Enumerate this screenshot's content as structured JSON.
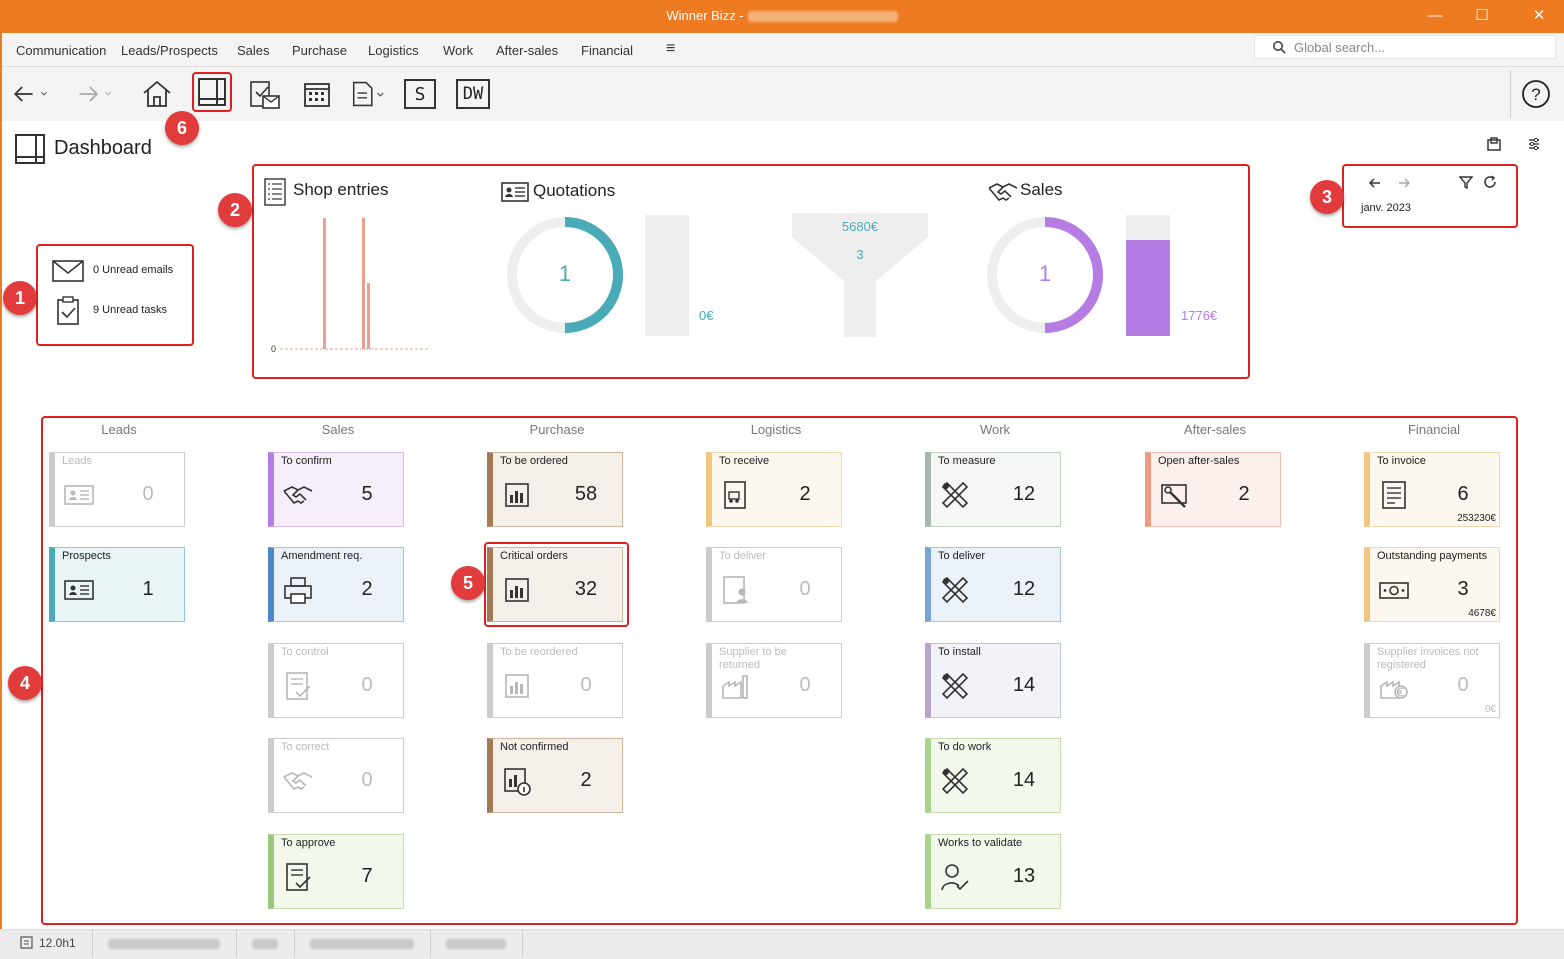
{
  "window": {
    "app_title": "Winner Bizz -"
  },
  "menu": {
    "items": [
      "Communication",
      "Leads/Prospects",
      "Sales",
      "Purchase",
      "Logistics",
      "Work",
      "After-sales",
      "Financial"
    ],
    "more_icon": "hamburger-icon"
  },
  "search": {
    "placeholder": "Global search..."
  },
  "page": {
    "title": "Dashboard"
  },
  "badges": {
    "b1": "1",
    "b2": "2",
    "b3": "3",
    "b4": "4",
    "b5": "5",
    "b6": "6"
  },
  "notifications": {
    "emails": "0 Unread emails",
    "tasks": "9 Unread tasks"
  },
  "kpi": {
    "shop_title": "Shop entries",
    "shop_axis_zero": "0",
    "quotations_title": "Quotations",
    "quotations_count": "1",
    "quotations_amount": "0€",
    "funnel_amount": "5680€",
    "funnel_count": "3",
    "sales_title": "Sales",
    "sales_count": "1",
    "sales_amount": "1776€",
    "colors": {
      "quotation_ring": "#49aab8",
      "sales_ring": "#b57de4",
      "shop_bars": "#ec9f90"
    }
  },
  "period": {
    "label": "janv. 2023"
  },
  "columns": [
    "Leads",
    "Sales",
    "Purchase",
    "Logistics",
    "Work",
    "After-sales",
    "Financial"
  ],
  "tiles": {
    "leads_leads": {
      "label": "Leads",
      "value": "0"
    },
    "leads_prospects": {
      "label": "Prospects",
      "value": "1"
    },
    "sales_confirm": {
      "label": "To confirm",
      "value": "5"
    },
    "sales_amend": {
      "label": "Amendment req.",
      "value": "2"
    },
    "sales_control": {
      "label": "To control",
      "value": "0"
    },
    "sales_correct": {
      "label": "To correct",
      "value": "0"
    },
    "sales_approve": {
      "label": "To approve",
      "value": "7"
    },
    "purch_ordered": {
      "label": "To be ordered",
      "value": "58"
    },
    "purch_critical": {
      "label": "Critical orders",
      "value": "32"
    },
    "purch_reorder": {
      "label": "To be reordered",
      "value": "0"
    },
    "purch_notconf": {
      "label": "Not confirmed",
      "value": "2"
    },
    "log_receive": {
      "label": "To receive",
      "value": "2"
    },
    "log_deliver": {
      "label": "To deliver",
      "value": "0"
    },
    "log_supplier": {
      "label": "Supplier to be returned",
      "value": "0"
    },
    "work_measure": {
      "label": "To measure",
      "value": "12"
    },
    "work_deliver": {
      "label": "To deliver",
      "value": "12"
    },
    "work_install": {
      "label": "To install",
      "value": "14"
    },
    "work_do": {
      "label": "To do work",
      "value": "14"
    },
    "work_validate": {
      "label": "Works to validate",
      "value": "13"
    },
    "as_open": {
      "label": "Open after-sales",
      "value": "2"
    },
    "fin_invoice": {
      "label": "To invoice",
      "value": "6",
      "amount": "253230€"
    },
    "fin_payments": {
      "label": "Outstanding payments",
      "value": "3",
      "amount": "4678€"
    },
    "fin_supplier": {
      "label": "Supplier invoices not registered",
      "value": "0",
      "amount": "0€"
    }
  },
  "status": {
    "version": "12.0h1"
  }
}
